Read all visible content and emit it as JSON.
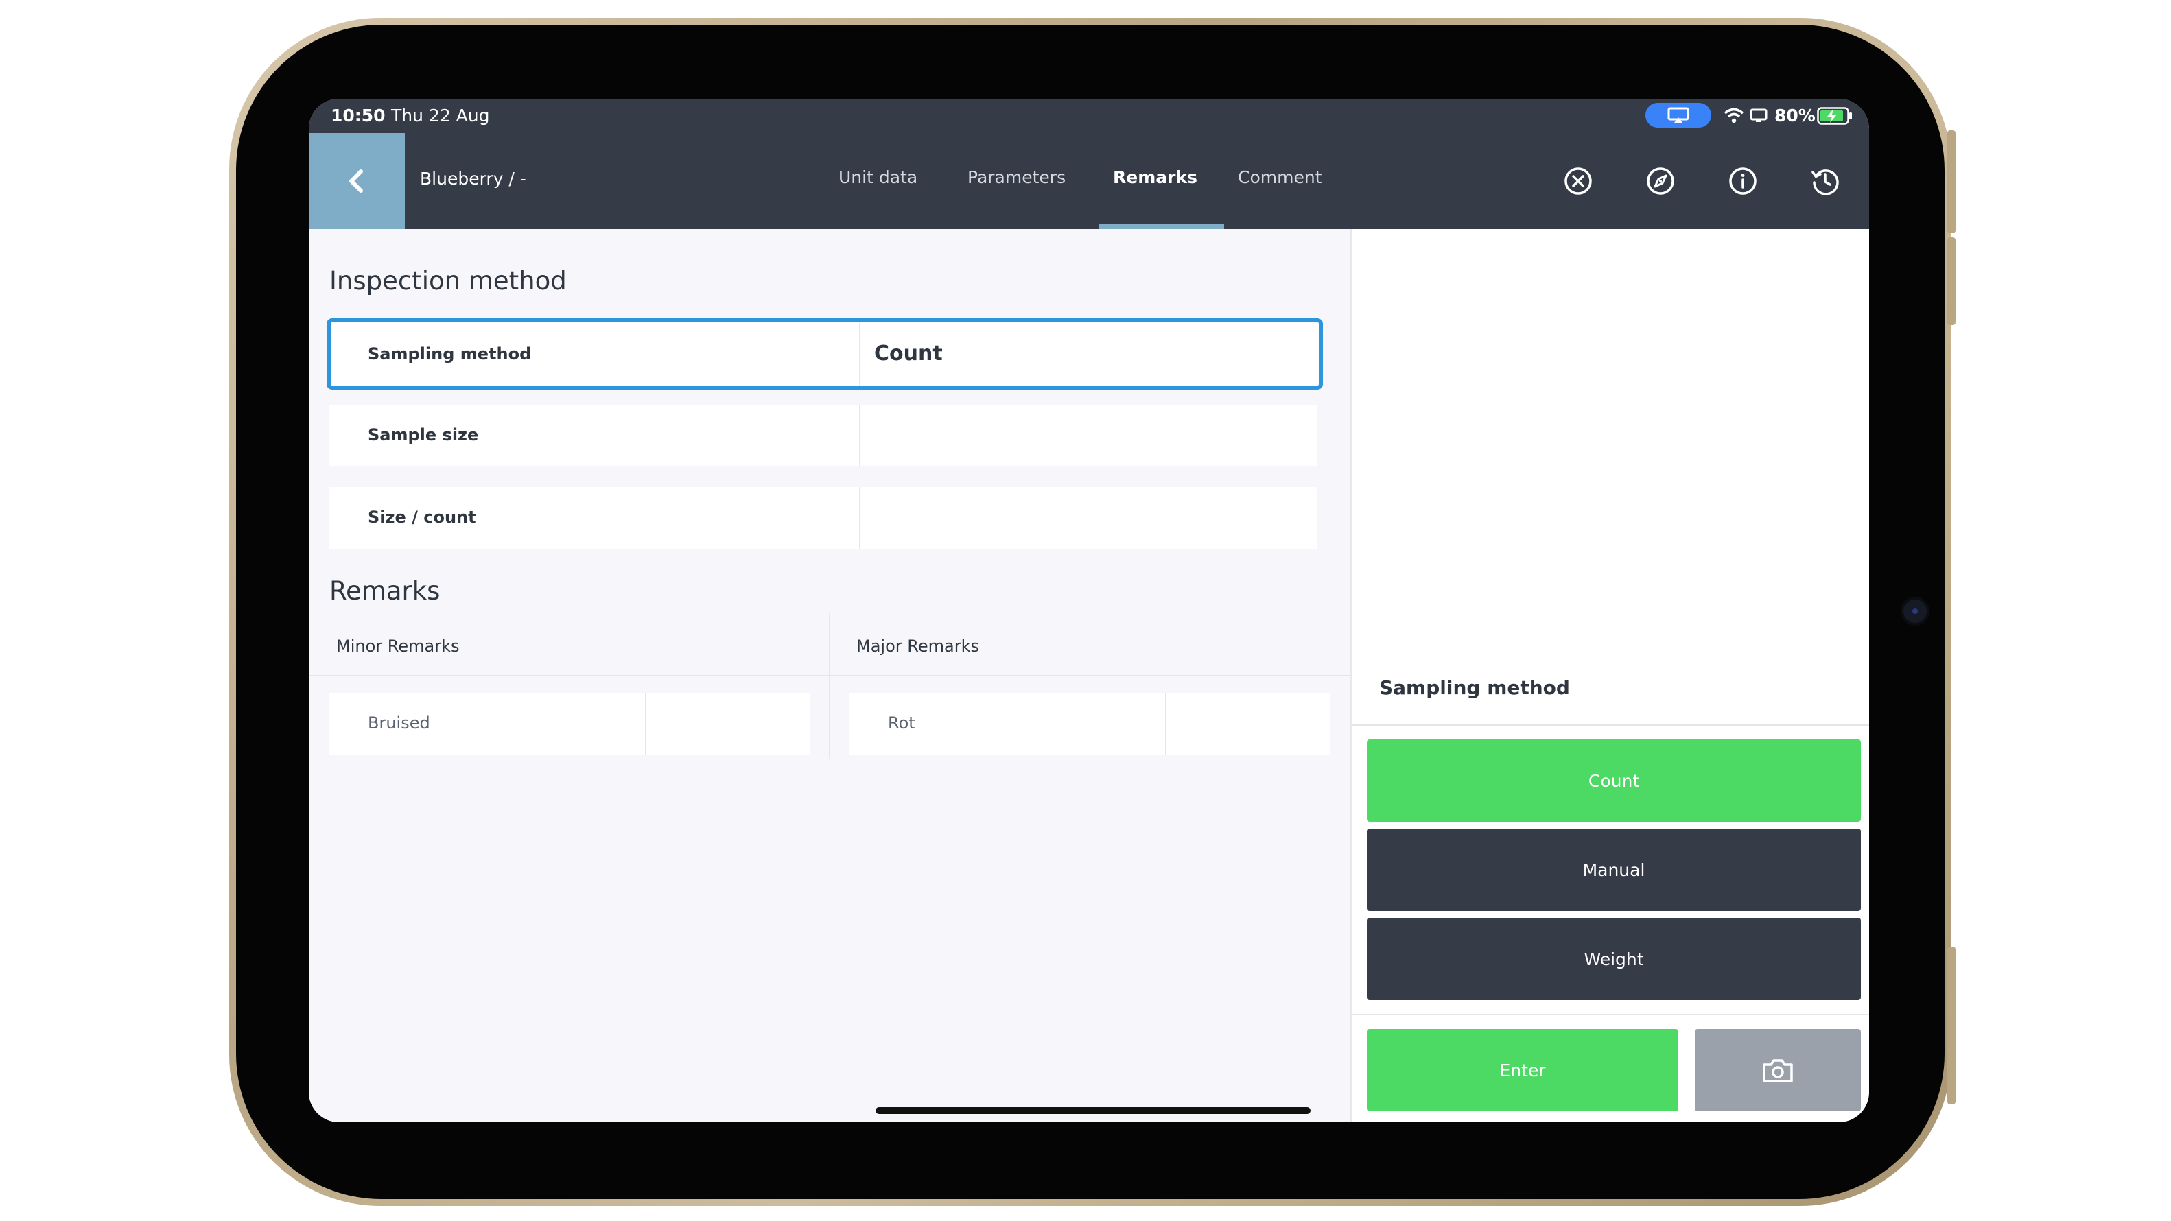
{
  "status_bar": {
    "time": "10:50",
    "date": "Thu 22 Aug",
    "battery": "80%"
  },
  "header": {
    "title": "Blueberry / -",
    "tabs": [
      {
        "label": "Unit data",
        "active": false
      },
      {
        "label": "Parameters",
        "active": false
      },
      {
        "label": "Remarks",
        "active": true
      },
      {
        "label": "Comment",
        "active": false
      }
    ],
    "icons": [
      "close-circle-icon",
      "compass-icon",
      "info-icon",
      "history-icon"
    ]
  },
  "inspection": {
    "title": "Inspection method",
    "rows": [
      {
        "label": "Sampling method",
        "value": "Count"
      },
      {
        "label": "Sample size",
        "value": ""
      },
      {
        "label": "Size / count",
        "value": ""
      }
    ]
  },
  "remarks": {
    "title": "Remarks",
    "minor": {
      "header": "Minor Remarks",
      "items": [
        "Bruised"
      ]
    },
    "major": {
      "header": "Major Remarks",
      "items": [
        "Rot"
      ]
    }
  },
  "side_panel": {
    "title": "Sampling method",
    "options": [
      {
        "label": "Count",
        "selected": true
      },
      {
        "label": "Manual",
        "selected": false
      },
      {
        "label": "Weight",
        "selected": false
      }
    ],
    "enter_label": "Enter"
  },
  "colors": {
    "nav_dark": "#353c47",
    "accent_blue": "#7facc6",
    "selection_blue": "#2d95dc",
    "green": "#4cd964",
    "gray_button": "#9aa1aa"
  }
}
